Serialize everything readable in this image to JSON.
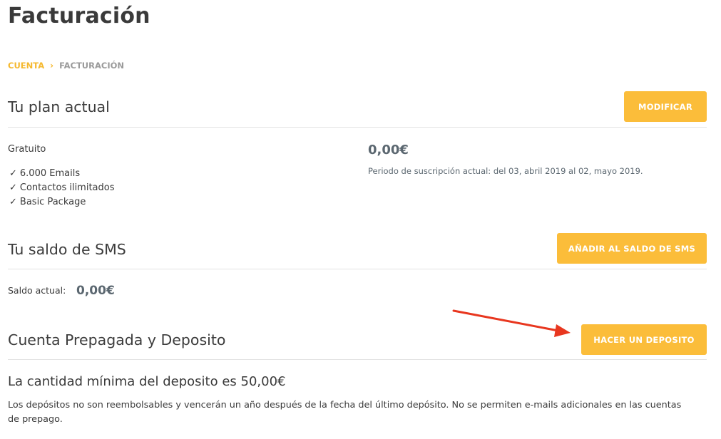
{
  "page": {
    "title": "Facturación"
  },
  "breadcrumb": {
    "parent": "CUENTA",
    "separator": "›",
    "current": "FACTURACIÓN"
  },
  "plan": {
    "section_title": "Tu plan actual",
    "button_label": "MODIFICAR",
    "name": "Gratuito",
    "features": [
      "6.000 Emails",
      "Contactos ilimitados",
      "Basic Package"
    ],
    "check_icon": "✓",
    "price": "0,00€",
    "period": "Periodo de suscripción actual: del 03, abril 2019 al 02, mayo 2019."
  },
  "sms": {
    "section_title": "Tu saldo de SMS",
    "button_label": "AÑADIR AL SALDO DE SMS",
    "balance_label": "Saldo actual:",
    "balance_value": "0,00€"
  },
  "prepaid": {
    "section_title": "Cuenta Prepagada y Deposito",
    "button_label": "HACER UN DEPOSITO",
    "min_deposit": "La cantidad mínima del deposito es 50,00€",
    "note": "Los depósitos no son reembolsables y vencerán un año después de la fecha del último depósito. No se permiten e-mails adicionales en las cuentas de prepago."
  },
  "colors": {
    "accent": "#fbbd3a",
    "breadcrumb_link": "#f5b82e",
    "annotation_arrow": "#e8371f"
  },
  "icons": {
    "annotation": "red-arrow-icon",
    "feature_check": "check-icon",
    "breadcrumb_separator": "chevron-right-icon"
  }
}
